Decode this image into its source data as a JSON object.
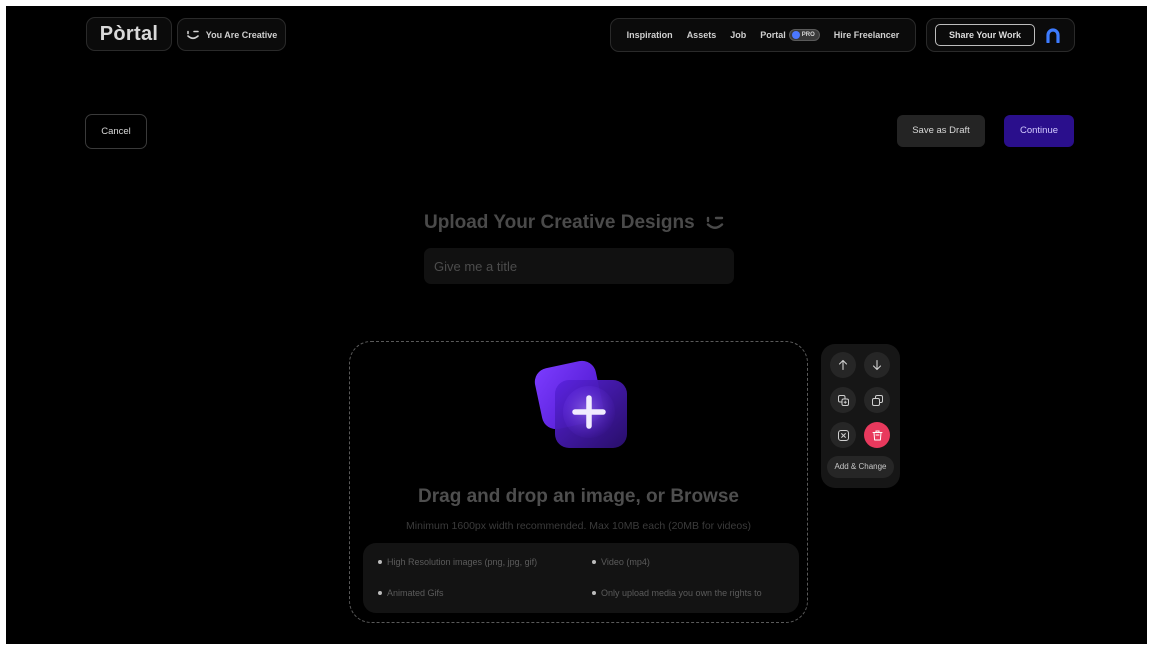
{
  "header": {
    "logo": "Pòrtal",
    "creative_label": "You Are Creative",
    "nav": [
      "Inspiration",
      "Assets",
      "Job"
    ],
    "portal_label": "Portal",
    "pro_badge": "PRO",
    "hire_label": "Hire Freelancer",
    "share_label": "Share Your Work"
  },
  "actions": {
    "cancel_label": "Cancel",
    "draft_label": "Save as Draft",
    "continue_label": "Continue"
  },
  "upload": {
    "heading": "Upload Your Creative Designs",
    "title_placeholder": "Give me a title",
    "title_value": "",
    "drag_text": "Drag and drop an image, or Browse",
    "hint": "Minimum 1600px width recommended. Max 10MB each (20MB for videos)",
    "requirements": [
      "High Resolution images (png, jpg, gif)",
      "Video (mp4)",
      "Animated Gifs",
      "Only upload media you own the rights to"
    ]
  },
  "toolbar": {
    "add_change_label": "Add & Change",
    "icons": [
      "arrow-up-icon",
      "arrow-down-icon",
      "duplicate-icon",
      "copy-icon",
      "close-square-icon",
      "trash-icon"
    ]
  },
  "colors": {
    "background": "#000000",
    "accent": "#2a0f8c",
    "upload_icon": "#6b2bff",
    "delete": "#e8395d",
    "pro_dot": "#4b78ff"
  }
}
